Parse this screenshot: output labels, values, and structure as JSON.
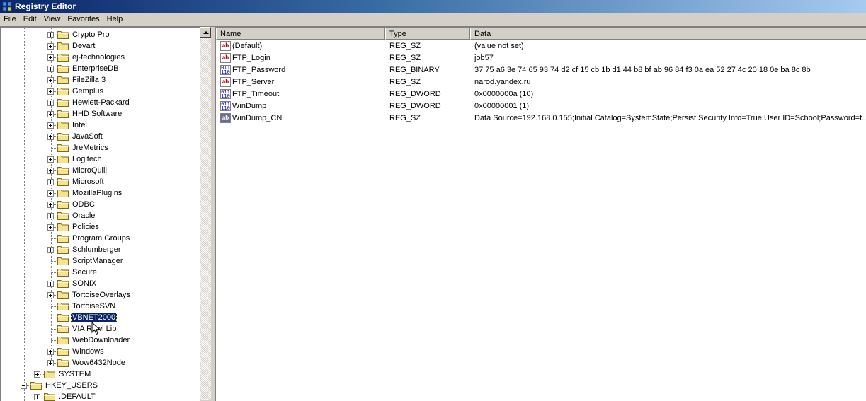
{
  "window": {
    "title": "Registry Editor"
  },
  "menu": [
    "File",
    "Edit",
    "View",
    "Favorites",
    "Help"
  ],
  "tree": {
    "items": [
      {
        "label": "Crypto Pro",
        "expander": "plus",
        "selected": false
      },
      {
        "label": "Devart",
        "expander": "plus",
        "selected": false
      },
      {
        "label": "ej-technologies",
        "expander": "plus",
        "selected": false
      },
      {
        "label": "EnterpriseDB",
        "expander": "plus",
        "selected": false
      },
      {
        "label": "FileZilla 3",
        "expander": "plus",
        "selected": false
      },
      {
        "label": "Gemplus",
        "expander": "plus",
        "selected": false
      },
      {
        "label": "Hewlett-Packard",
        "expander": "plus",
        "selected": false
      },
      {
        "label": "HHD Software",
        "expander": "plus",
        "selected": false
      },
      {
        "label": "Intel",
        "expander": "plus",
        "selected": false
      },
      {
        "label": "JavaSoft",
        "expander": "plus",
        "selected": false
      },
      {
        "label": "JreMetrics",
        "expander": "none",
        "selected": false
      },
      {
        "label": "Logitech",
        "expander": "plus",
        "selected": false
      },
      {
        "label": "MicroQuill",
        "expander": "plus",
        "selected": false
      },
      {
        "label": "Microsoft",
        "expander": "plus",
        "selected": false
      },
      {
        "label": "MozillaPlugins",
        "expander": "plus",
        "selected": false
      },
      {
        "label": "ODBC",
        "expander": "plus",
        "selected": false
      },
      {
        "label": "Oracle",
        "expander": "plus",
        "selected": false
      },
      {
        "label": "Policies",
        "expander": "plus",
        "selected": false
      },
      {
        "label": "Program Groups",
        "expander": "none",
        "selected": false
      },
      {
        "label": "Schlumberger",
        "expander": "plus",
        "selected": false
      },
      {
        "label": "ScriptManager",
        "expander": "none",
        "selected": false
      },
      {
        "label": "Secure",
        "expander": "none",
        "selected": false
      },
      {
        "label": "SONIX",
        "expander": "plus",
        "selected": false
      },
      {
        "label": "TortoiseOverlays",
        "expander": "plus",
        "selected": false
      },
      {
        "label": "TortoiseSVN",
        "expander": "none",
        "selected": false
      },
      {
        "label": "VBNET2000",
        "expander": "none",
        "selected": true
      },
      {
        "label": "VIA Rawl Lib",
        "expander": "none",
        "selected": false
      },
      {
        "label": "WebDownloader",
        "expander": "none",
        "selected": false
      },
      {
        "label": "Windows",
        "expander": "plus",
        "selected": false
      },
      {
        "label": "Wow6432Node",
        "expander": "plus",
        "selected": false
      }
    ],
    "system": {
      "label": "SYSTEM"
    },
    "hkey_users": {
      "label": "HKEY_USERS"
    },
    "default": {
      "label": ".DEFAULT"
    }
  },
  "list": {
    "columns": [
      "Name",
      "Type",
      "Data"
    ],
    "rows": [
      {
        "icon": "string-value-icon",
        "name": "(Default)",
        "type": "REG_SZ",
        "data": "(value not set)"
      },
      {
        "icon": "string-value-icon",
        "name": "FTP_Login",
        "type": "REG_SZ",
        "data": "job57"
      },
      {
        "icon": "binary-value-icon",
        "name": "FTP_Password",
        "type": "REG_BINARY",
        "data": "37 75 a6 3e 74 65 93 74 d2 cf 15 cb 1b d1 44 b8 bf ab 96 84 f3 0a ea 52 27 4c 20 18 0e ba 8c 8b"
      },
      {
        "icon": "string-value-icon",
        "name": "FTP_Server",
        "type": "REG_SZ",
        "data": "narod.yandex.ru"
      },
      {
        "icon": "binary-value-icon",
        "name": "FTP_Timeout",
        "type": "REG_DWORD",
        "data": "0x0000000a (10)"
      },
      {
        "icon": "binary-value-icon",
        "name": "WinDump",
        "type": "REG_DWORD",
        "data": "0x00000001 (1)"
      },
      {
        "icon": "string-value-selected-icon",
        "name": "WinDump_CN",
        "type": "REG_SZ",
        "data": "Data Source=192.168.0.155;Initial Catalog=SystemState;Persist Security Info=True;User ID=School;Password=f..."
      }
    ]
  }
}
